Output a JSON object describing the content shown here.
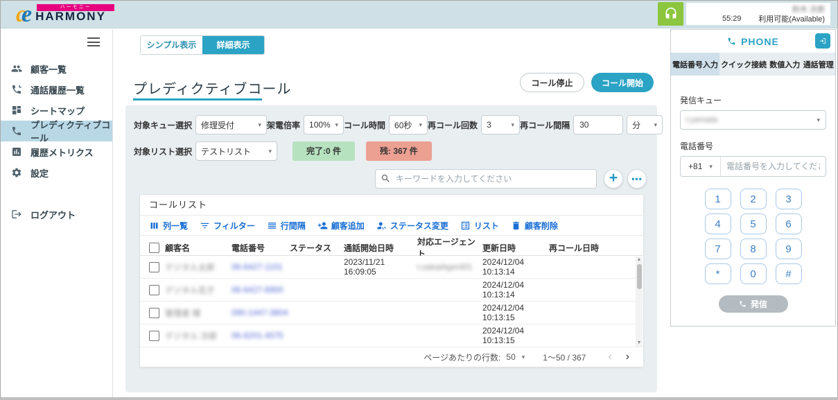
{
  "colors": {
    "accent_teal": "#2ba3c4",
    "header_bg": "#cfe1e6",
    "sidebar_active_bg": "#b9d8e6",
    "toolbar_link_blue": "#1a6fd4",
    "badge_done_bg": "#b7e2bf",
    "badge_remain_bg": "#eca092",
    "headset_green": "#8cc63e",
    "dial_key_border": "#a9c8e8",
    "dial_key_text": "#3b7fc4",
    "call_button_disabled_bg": "#b4bcc1",
    "logo_pink": "#e6007e"
  },
  "header": {
    "brand": "HARMONY",
    "brand_banner": "ハーモニー",
    "agent_name_redacted": "鈴木 次郎",
    "timer": "55:29",
    "availability": "利用可能(Available)"
  },
  "sidebar": {
    "items": [
      {
        "label": "顧客一覧",
        "icon": "people-icon",
        "active": false
      },
      {
        "label": "通話履歴一覧",
        "icon": "phone-history-icon",
        "active": false
      },
      {
        "label": "シートマップ",
        "icon": "seat-map-icon",
        "active": false
      },
      {
        "label": "プレディクティブコール",
        "icon": "predictive-call-icon",
        "active": true
      },
      {
        "label": "履歴メトリクス",
        "icon": "metrics-icon",
        "active": false
      },
      {
        "label": "設定",
        "icon": "gear-icon",
        "active": false
      }
    ],
    "logout": {
      "label": "ログアウト",
      "icon": "logout-icon"
    }
  },
  "main": {
    "view_tabs": {
      "simple": "シンプル表示",
      "detail": "詳細表示",
      "selected": "詳細表示"
    },
    "page_title": "プレディクティブコール",
    "call_stop": "コール停止",
    "call_start": "コール開始",
    "form": {
      "queue_label": "対象キュー選択",
      "queue_value": "修理受付",
      "rate_label": "架電倍率",
      "rate_value": "100%",
      "duration_label": "コール時間",
      "duration_value": "60秒",
      "retry_count_label": "再コール回数",
      "retry_count_value": "3",
      "retry_interval_label": "再コール間隔",
      "retry_interval_value": "30",
      "retry_interval_unit": "分",
      "list_label": "対象リスト選択",
      "list_value": "テストリスト",
      "done_badge": "完了:0 件",
      "remain_badge": "残: 367 件"
    },
    "search_placeholder": "キーワードを入力してください",
    "call_list": {
      "title": "コールリスト",
      "toolbar": [
        {
          "label": "列一覧",
          "icon": "columns-icon"
        },
        {
          "label": "フィルター",
          "icon": "filter-icon"
        },
        {
          "label": "行間隔",
          "icon": "row-height-icon"
        },
        {
          "label": "顧客追加",
          "icon": "person-add-icon"
        },
        {
          "label": "ステータス変更",
          "icon": "person-sync-icon"
        },
        {
          "label": "リスト",
          "icon": "list-icon"
        },
        {
          "label": "顧客削除",
          "icon": "trash-icon"
        }
      ],
      "columns": [
        "顧客名",
        "電話番号",
        "ステータス",
        "通話開始日時",
        "対応エージェント",
        "更新日時",
        "再コール日時"
      ],
      "rows": [
        {
          "name_redacted": "デジタル太郎",
          "phone_redacted": "06-6427-1101",
          "status": "",
          "call_start": "2023/11/21 16:09:05",
          "agent_redacted": "t.sakaiAgent01",
          "updated": "2024/12/04 10:13:14",
          "recall": ""
        },
        {
          "name_redacted": "デジタル花子",
          "phone_redacted": "06-6427-8900",
          "status": "",
          "call_start": "",
          "agent_redacted": "",
          "updated": "2024/12/04 10:13:14",
          "recall": ""
        },
        {
          "name_redacted": "管理者 様",
          "phone_redacted": "090-1447-3804",
          "status": "",
          "call_start": "",
          "agent_redacted": "",
          "updated": "2024/12/04 10:13:15",
          "recall": ""
        },
        {
          "name_redacted": "デジタル 次郎",
          "phone_redacted": "06-6201-4575",
          "status": "",
          "call_start": "",
          "agent_redacted": "",
          "updated": "2024/12/04 10:13:15",
          "recall": ""
        }
      ],
      "pagination": {
        "rows_per_page_label": "ページあたりの行数:",
        "rows_per_page": "50",
        "range": "1〜50 / 367"
      }
    }
  },
  "phone_panel": {
    "title": "PHONE",
    "tabs": [
      {
        "label": "電話番号入力",
        "active": true
      },
      {
        "label": "クイック接続",
        "active": false
      },
      {
        "label": "数値入力",
        "active": false
      },
      {
        "label": "通話管理",
        "active": false
      }
    ],
    "queue_label": "発信キュー",
    "queue_value_redacted": "t.yamada",
    "phone_label": "電話番号",
    "country_code": "+81",
    "phone_placeholder": "電話番号を入力してください",
    "dialpad": [
      "1",
      "2",
      "3",
      "4",
      "5",
      "6",
      "7",
      "8",
      "9",
      "*",
      "0",
      "#"
    ],
    "call_button": "発信"
  }
}
